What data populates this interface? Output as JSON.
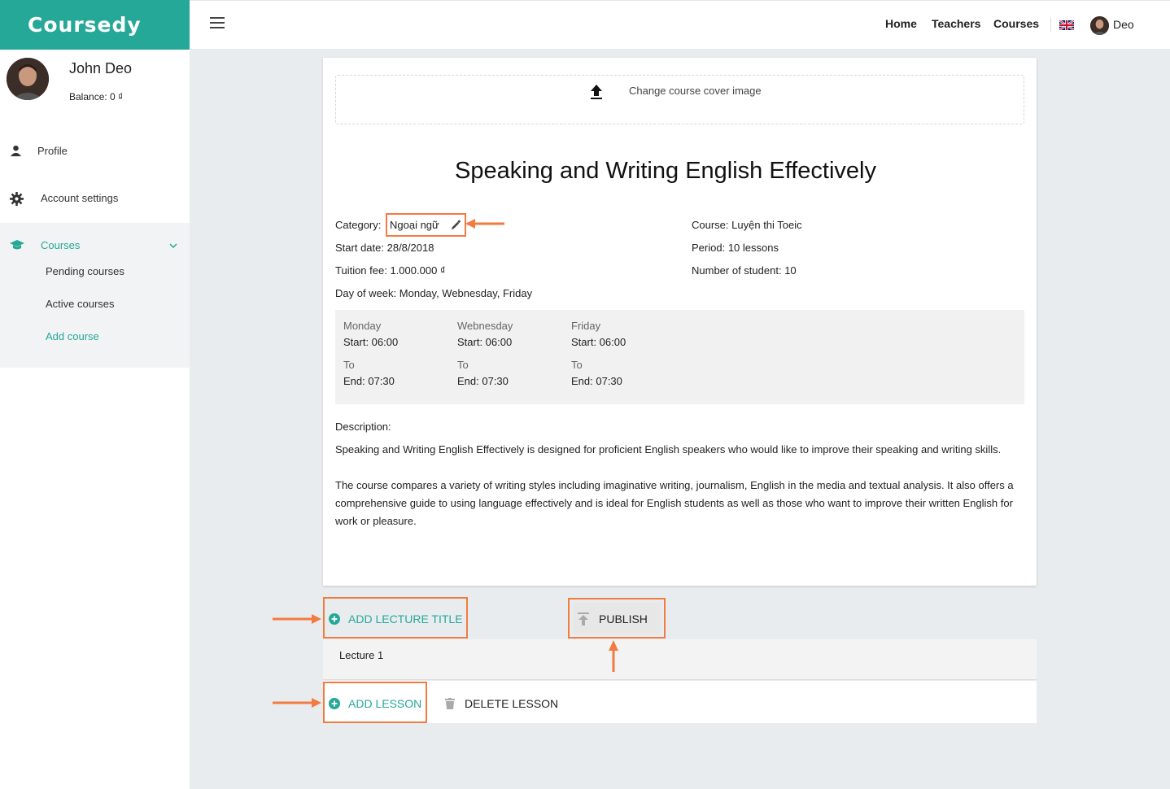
{
  "brand": "Coursedy",
  "user": {
    "name": "John Deo",
    "balance_label": "Balance:",
    "balance_value": "0 ₫"
  },
  "sidebar": {
    "profile": "Profile",
    "account_settings": "Account settings",
    "courses": "Courses",
    "sub_items": [
      "Pending courses",
      "Active courses",
      "Add course"
    ]
  },
  "topbar": {
    "nav": [
      "Home",
      "Teachers",
      "Courses"
    ],
    "user_short": "Deo"
  },
  "cover": {
    "text": "Change course cover image"
  },
  "course": {
    "title": "Speaking and Writing English Effectively",
    "category_label": "Category:",
    "category_value": "Ngoại ngữ",
    "start_date_label": "Start date:",
    "start_date_value": "28/8/2018",
    "tuition_label": "Tuition fee:",
    "tuition_value": "1.000.000 ₫",
    "day_of_week_label": "Day of week:",
    "day_of_week_value": "Monday, Webnesday, Friday",
    "course_label": "Course:",
    "course_value": "Luyện thi Toeic",
    "period_label": "Period:",
    "period_value": "10 lessons",
    "students_label": "Number of student:",
    "students_value": "10"
  },
  "schedule": [
    {
      "day": "Monday",
      "start": "Start: 06:00",
      "to": "To",
      "end": "End: 07:30"
    },
    {
      "day": "Webnesday",
      "start": "Start: 06:00",
      "to": "To",
      "end": "End: 07:30"
    },
    {
      "day": "Friday",
      "start": "Start: 06:00",
      "to": "To",
      "end": "End: 07:30"
    }
  ],
  "description": {
    "label": "Description:",
    "p1": "Speaking and Writing English Effectively is designed for proficient English speakers who would like to improve their speaking and writing skills.",
    "p2": "The course compares a variety of writing styles including imaginative writing, journalism, English in the media and textual analysis. It also offers a comprehensive guide to using language effectively and is ideal for English students as well as those who want to improve their written English for work or pleasure."
  },
  "actions": {
    "add_lecture_title": "ADD LECTURE TITLE",
    "publish": "PUBLISH",
    "lecture_1": "Lecture 1",
    "add_lesson": "ADD LESSON",
    "delete_lesson": "DELETE LESSON"
  },
  "colors": {
    "brand": "#25a898",
    "highlight": "#f27b3f",
    "background": "#e9ecef"
  }
}
